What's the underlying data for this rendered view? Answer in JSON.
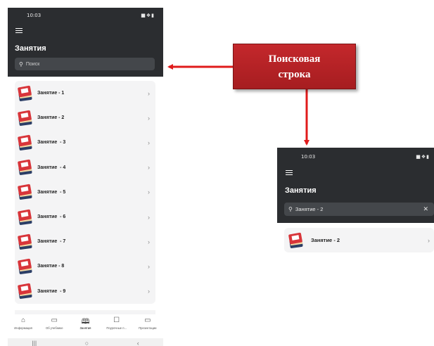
{
  "left_screen": {
    "status_time": "10:03",
    "status_icons": "■ ❖ ▮",
    "title": "Занятия",
    "search_placeholder": "Поиск",
    "items": [
      {
        "label": "Занятие - 1"
      },
      {
        "label": "Занятие - 2"
      },
      {
        "label": "Занятие  - 3"
      },
      {
        "label": "Занятие  - 4"
      },
      {
        "label": "Занятие  - 5"
      },
      {
        "label": "Занятие  - 6"
      },
      {
        "label": "Занятие  - 7"
      },
      {
        "label": "Занятие - 8"
      },
      {
        "label": "Занятие  - 9"
      }
    ],
    "bottom_nav": [
      {
        "label": "Информация",
        "icon": "home-icon",
        "glyph": "⌂"
      },
      {
        "label": "Об учебнике",
        "icon": "folder-icon",
        "glyph": "▭"
      },
      {
        "label": "Занятия",
        "icon": "book-open-icon",
        "glyph": "🕮"
      },
      {
        "label": "Поурочные п...",
        "icon": "inbox-icon",
        "glyph": "☐"
      },
      {
        "label": "Презентации",
        "icon": "presentation-icon",
        "glyph": "▭"
      }
    ],
    "active_nav": "Занятия"
  },
  "callout": {
    "line1": "Поисковая",
    "line2": "строка",
    "color": "#b82327"
  },
  "right_screen": {
    "status_time": "10:03",
    "title": "Занятия",
    "search_value": "Занятие - 2",
    "result": "Занятие - 2"
  },
  "colors": {
    "header": "#2b2d30",
    "list_bg": "#f4f4f5",
    "arrow": "#e01b1b"
  }
}
